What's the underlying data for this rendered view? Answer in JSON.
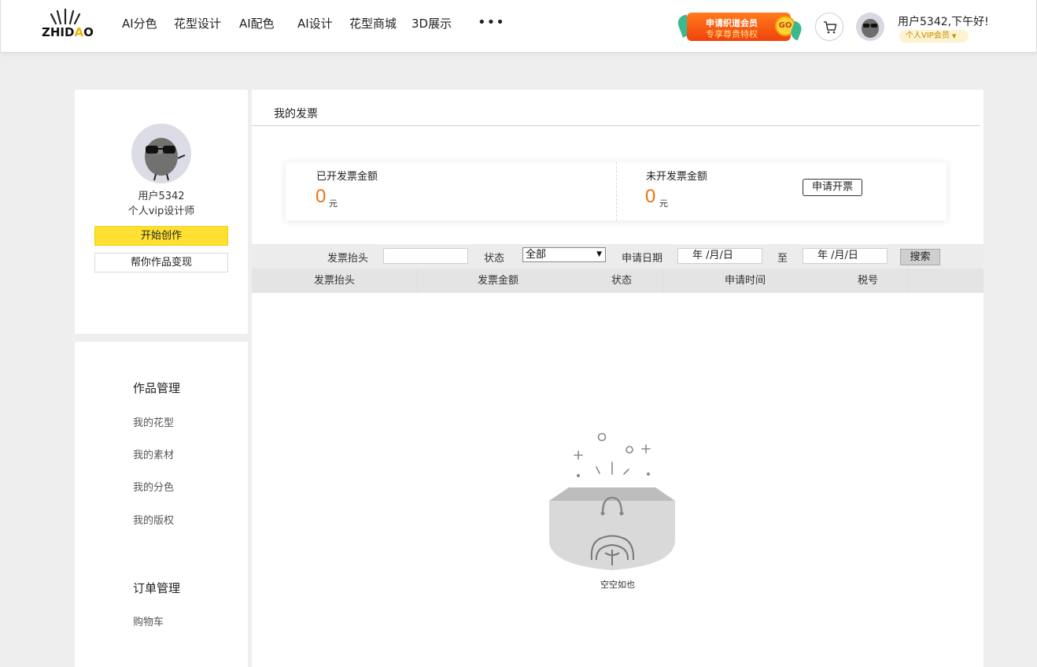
{
  "header": {
    "logo": {
      "prefix": "ZHID",
      "accent": "A",
      "suffix": "O"
    },
    "nav": [
      "AI分色",
      "花型设计",
      "AI配色",
      "AI设计",
      "花型商城",
      "3D展示"
    ],
    "more": "•••",
    "vip_banner": {
      "line1": "申请织道会员",
      "line2": "专享尊贵特权",
      "go": "GO"
    },
    "greeting": "用户5342,下午好!",
    "vip_tag": "个人VIP会员"
  },
  "profile": {
    "name": "用户5342",
    "role": "个人vip设计师",
    "create_button": "开始创作",
    "monetize_button": "帮你作品变现"
  },
  "menu": {
    "sections": [
      {
        "title": "作品管理",
        "items": [
          "我的花型",
          "我的素材",
          "我的分色",
          "我的版权"
        ]
      },
      {
        "title": "订单管理",
        "items": [
          "购物车"
        ]
      }
    ]
  },
  "main": {
    "title": "我的发票",
    "issued": {
      "label": "已开发票金额",
      "value": "0",
      "unit": "元"
    },
    "unissued": {
      "label": "未开发票金额",
      "value": "0",
      "unit": "元"
    },
    "apply_button": "申请开票",
    "filter": {
      "title_label": "发票抬头",
      "title_value": "",
      "status_label": "状态",
      "status_value": "全部",
      "date_label": "申请日期",
      "date_from": "年 /月/日",
      "to": "至",
      "date_to": "年 /月/日",
      "search_button": "搜索"
    },
    "columns": [
      "发票抬头",
      "发票金额",
      "状态",
      "申请时间",
      "税号"
    ],
    "empty_text": "空空如也"
  },
  "colors": {
    "accent_yellow": "#ffe033",
    "amount_orange": "#f07010",
    "vip_orange": "#f0420c"
  }
}
